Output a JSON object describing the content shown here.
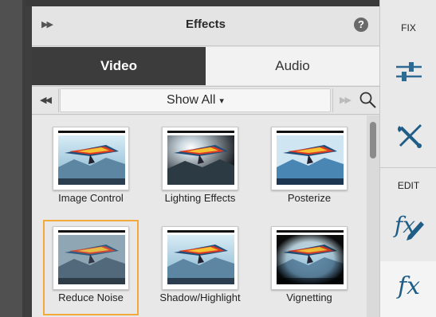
{
  "panel": {
    "title": "Effects",
    "help_glyph": "?",
    "collapse_icon": "double-chevron-right-icon",
    "tabs": [
      {
        "label": "Video",
        "active": true
      },
      {
        "label": "Audio",
        "active": false
      }
    ],
    "filter": {
      "value": "Show All",
      "caret": "▾"
    }
  },
  "effects": [
    {
      "label": "Image Control",
      "variant": "normal",
      "selected": false
    },
    {
      "label": "Lighting Effects",
      "variant": "lighting",
      "selected": false
    },
    {
      "label": "Posterize",
      "variant": "posterize",
      "selected": false
    },
    {
      "label": "Reduce Noise",
      "variant": "noise",
      "selected": true
    },
    {
      "label": "Shadow/Highlight",
      "variant": "normal",
      "selected": false
    },
    {
      "label": "Vignetting",
      "variant": "vignette",
      "selected": false
    }
  ],
  "right_panel": {
    "fix_label": "FIX",
    "edit_label": "EDIT",
    "fx_text": "fx"
  },
  "colors": {
    "accent_selected": "#f2a93b",
    "tab_active_bg": "#3c3c3c",
    "icon_blue": "#1f5d86"
  }
}
